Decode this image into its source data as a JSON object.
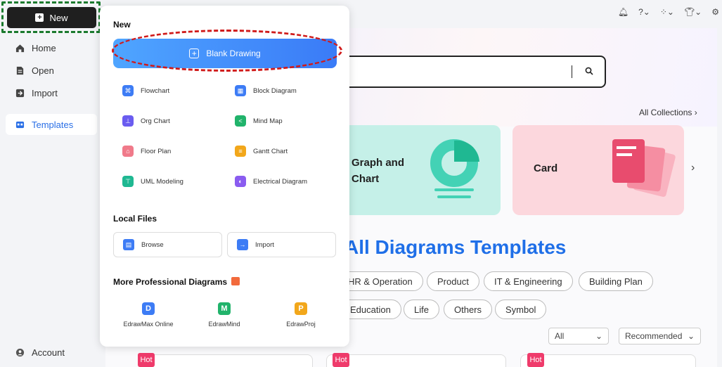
{
  "sidebar": {
    "new_label": "New",
    "items": [
      {
        "label": "Home",
        "icon": "home-icon"
      },
      {
        "label": "Open",
        "icon": "file-icon"
      },
      {
        "label": "Import",
        "icon": "import-icon"
      },
      {
        "label": "Templates",
        "icon": "templates-icon"
      }
    ],
    "account_label": "Account"
  },
  "popup": {
    "new_heading": "New",
    "blank_drawing": "Blank Drawing",
    "templates": [
      {
        "label": "Flowchart",
        "icon": "flowchart-icon",
        "color": "#3d7cf5"
      },
      {
        "label": "Block Diagram",
        "icon": "block-diagram-icon",
        "color": "#3d7cf5"
      },
      {
        "label": "Org Chart",
        "icon": "org-chart-icon",
        "color": "#6a5cf0"
      },
      {
        "label": "Mind Map",
        "icon": "mind-map-icon",
        "color": "#21b36b"
      },
      {
        "label": "Floor Plan",
        "icon": "floor-plan-icon",
        "color": "#f07a8a"
      },
      {
        "label": "Gantt Chart",
        "icon": "gantt-chart-icon",
        "color": "#f2a71b"
      },
      {
        "label": "UML Modeling",
        "icon": "uml-icon",
        "color": "#1fb892"
      },
      {
        "label": "Electrical Diagram",
        "icon": "electrical-icon",
        "color": "#8a5cf0"
      }
    ],
    "local_heading": "Local Files",
    "browse": "Browse",
    "import": "Import",
    "pro_heading": "More Professional Diagrams",
    "pro_items": [
      {
        "label": "EdrawMax Online",
        "icon": "edrawmax-icon",
        "color": "#3d7cf5"
      },
      {
        "label": "EdrawMind",
        "icon": "edrawmind-icon",
        "color": "#21b36b"
      },
      {
        "label": "EdrawProj",
        "icon": "edrawproj-icon",
        "color": "#f2a71b"
      }
    ]
  },
  "main": {
    "all_collections": "All Collections",
    "cards": [
      {
        "title_line1": "Graph and",
        "title_line2": "Chart"
      },
      {
        "title": "Card"
      }
    ],
    "templates_title": "All Diagrams Templates",
    "chips_row1": [
      "HR & Operation",
      "Product",
      "IT & Engineering",
      "Building Plan"
    ],
    "chips_row2": [
      "Education",
      "Life",
      "Others",
      "Symbol"
    ],
    "filter_all": "All",
    "sort_recommended": "Recommended",
    "hot": "Hot"
  }
}
